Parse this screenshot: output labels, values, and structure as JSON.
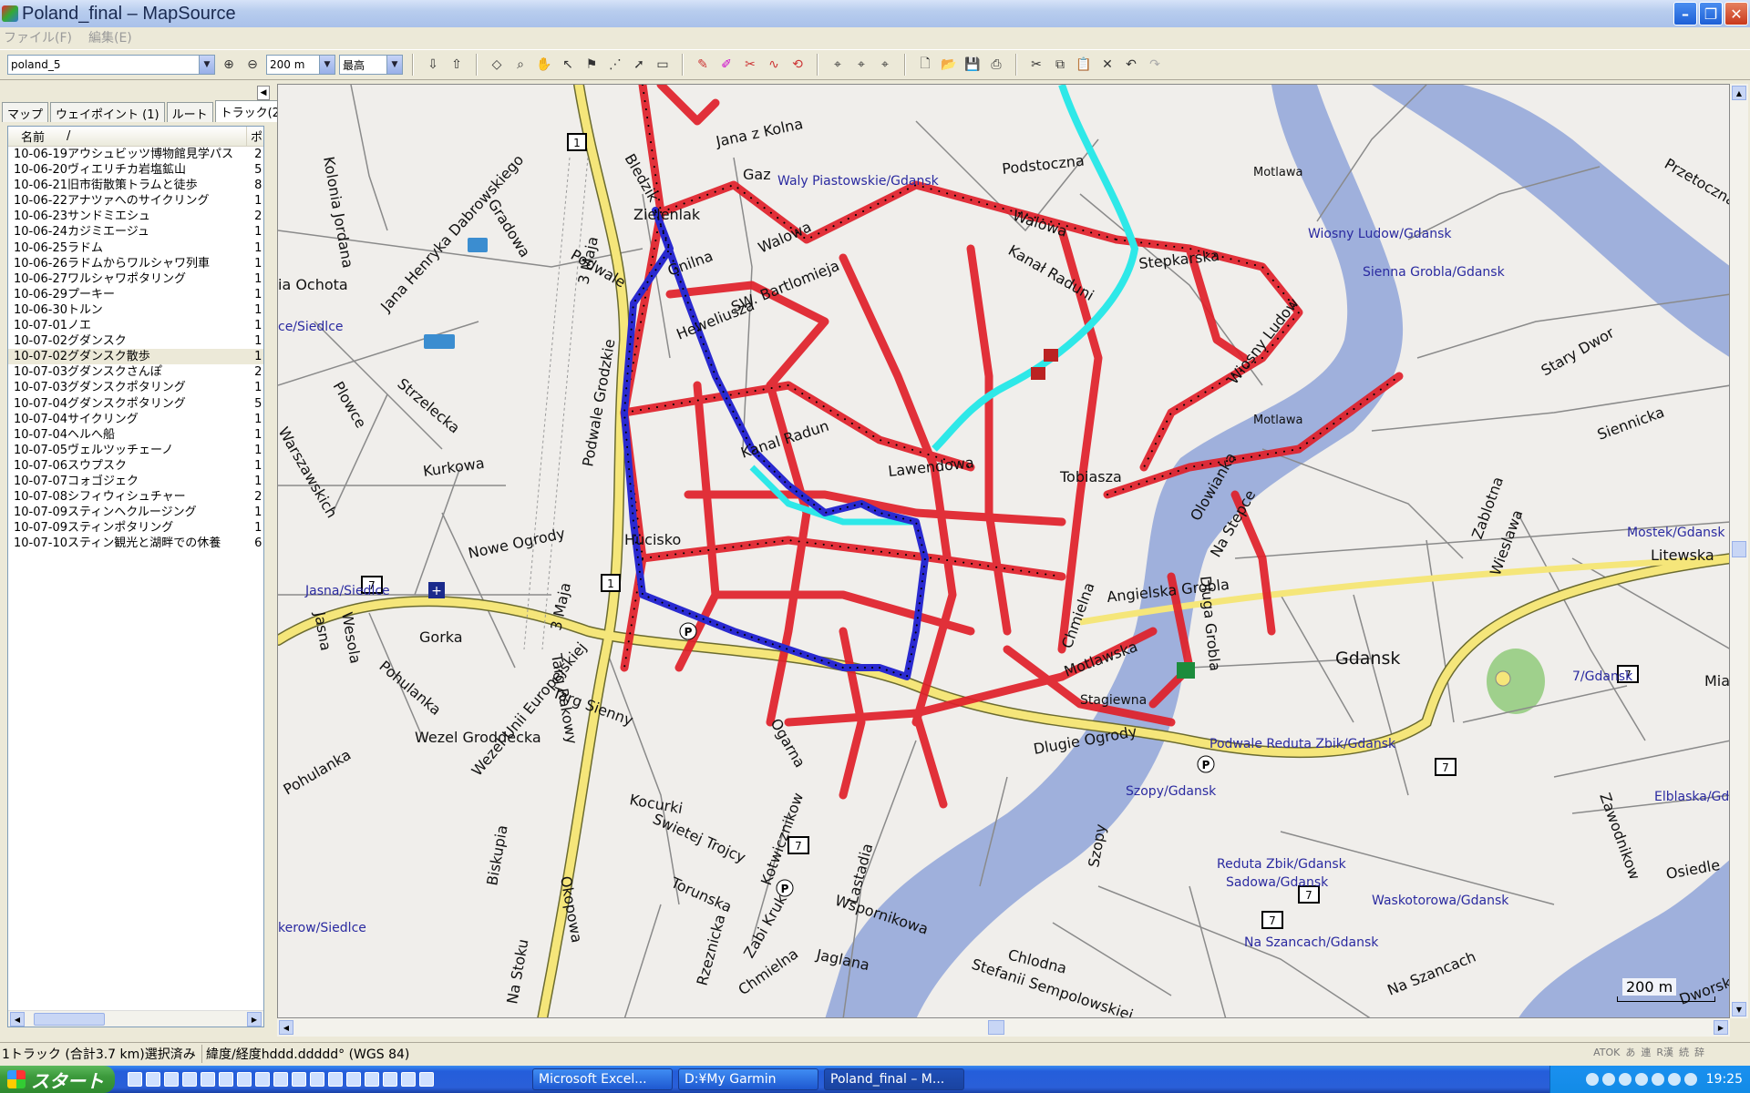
{
  "window": {
    "title": "Poland_final – MapSource"
  },
  "menu": [
    "ファイル(F)",
    "編集(E)"
  ],
  "toolbar": {
    "map_select": "poland_5",
    "zoom": "200 m",
    "detail": "最高"
  },
  "tabs": [
    "マップ",
    "ウェイポイント (1)",
    "ルート",
    "トラック(26)"
  ],
  "list": {
    "col_name": "名前",
    "col_sort": "/",
    "col_points": "ポ",
    "tracks": [
      {
        "name": "10-06-19アウシュビッツ博物館見学パス",
        "v": "2"
      },
      {
        "name": "10-06-20ヴィエリチカ岩塩鉱山",
        "v": "5"
      },
      {
        "name": "10-06-21旧市街散策トラムと徒歩",
        "v": "8"
      },
      {
        "name": "10-06-22アナツァへのサイクリング",
        "v": "1"
      },
      {
        "name": "10-06-23サンドミエシュ",
        "v": "2"
      },
      {
        "name": "10-06-24カジミエージュ",
        "v": "1"
      },
      {
        "name": "10-06-25ラドム",
        "v": "1"
      },
      {
        "name": "10-06-26ラドムからワルシャワ列車",
        "v": "1"
      },
      {
        "name": "10-06-27ワルシャワポタリング",
        "v": "1"
      },
      {
        "name": "10-06-29プーキー",
        "v": "1"
      },
      {
        "name": "10-06-30トルン",
        "v": "1"
      },
      {
        "name": "10-07-01ノエ",
        "v": "1"
      },
      {
        "name": "10-07-02グダンスク",
        "v": "1"
      },
      {
        "name": "10-07-02グダンスク散歩",
        "v": "1"
      },
      {
        "name": "10-07-03グダンスクさんぽ",
        "v": "2"
      },
      {
        "name": "10-07-03グダンスクポタリング",
        "v": "1"
      },
      {
        "name": "10-07-04グダンスクポタリング",
        "v": "5"
      },
      {
        "name": "10-07-04サイクリング",
        "v": "1"
      },
      {
        "name": "10-07-04ヘルへ船",
        "v": "1"
      },
      {
        "name": "10-07-05ヴェルツッチェーノ",
        "v": "1"
      },
      {
        "name": "10-07-06スウプスク",
        "v": "1"
      },
      {
        "name": "10-07-07コォゴジェク",
        "v": "1"
      },
      {
        "name": "10-07-08シフィウィシュチャー",
        "v": "2"
      },
      {
        "name": "10-07-09スティンヘクルージング",
        "v": "1"
      },
      {
        "name": "10-07-09スティンポタリング",
        "v": "1"
      },
      {
        "name": "10-07-10スティン観光と湖畔での休養",
        "v": "6"
      }
    ],
    "selected_index": 13
  },
  "map": {
    "labels": {
      "jana_z_kolna": "Jana z Kolna",
      "gaz": "Gaz",
      "waly_piastowskie": "Waly Piastowskie/Gdansk",
      "podstoczna": "Podstoczna",
      "walowa1": "Walowa",
      "walowa2": "Walowa",
      "kanal_raduni1": "Kanał Raduni",
      "kanal_raduni2": "Kanal Radun",
      "stepkarska": "Stepkarska",
      "wiosny_ludow_gdansk": "Wiosny Ludow/Gdansk",
      "sienna_grobla": "Sienna Grobla/Gdansk",
      "wiosny_ludow": "Wiosny Ludow",
      "motlawa1": "Motlawa",
      "motlawa2": "Motlawa",
      "motlawska": "Motlawska",
      "gdansk": "Gdansk",
      "nowe_ogrody": "Nowe Ogrody",
      "hucisko": "Hucisko",
      "kurkowa": "Kurkowa",
      "gorka": "Gorka",
      "wezel_groddecka": "Wezel Groddecka",
      "wezel_unii": "Wezel Unii Europejskiej",
      "kocurki": "Kocurki",
      "swietej_trojcy": "Swietej Trojcy",
      "torunska": "Torunska",
      "chmielna": "Chmielna",
      "wspornikowa": "Wspornikowa",
      "jaglana": "Jaglana",
      "stefanii": "Stefanii Sempolowskiej",
      "chlodna": "Chlodna",
      "na_szancach": "Na Szancach",
      "na_szancach_gdansk": "Na Szancach/Gdansk",
      "angielska_grobla": "Angielska Grobla",
      "dlugie_ogrody": "Dlugie Ogrody",
      "dluga_grobla": "Dluga Grobla",
      "podwale_reduta": "Podwale Reduta Zbik/Gdansk",
      "reduta_zbik": "Reduta Zbik/Gdansk",
      "sadowa_gdansk": "Sadowa/Gdansk",
      "waskotorowa": "Waskotorowa/Gdansk",
      "elblaska": "Elblaska/Gda",
      "litewska": "Litewska",
      "mostek": "Mostek/Gdansk",
      "tobiasza": "Tobiasza",
      "lawendowa": "Lawendowa",
      "podwale_grodzkie": "Podwale Grodzkie",
      "heweliusza": "Heweliusza",
      "sw_bartlomieja": "SW. Bartlomieja",
      "gnilna": "Gnilna",
      "targ_sienny": "Targ Sienny",
      "targ_rakowy": "Targ Rakowy",
      "okopowa": "Okopowa",
      "biskupia": "Biskupia",
      "na_stoku": "Na Stoku",
      "ogarna": "Ogarna",
      "chmielna2": "Chmielna",
      "olowianka": "Olowianka",
      "na_stepce": "Na Stepce",
      "zabi_kruk": "Zabi Kruk",
      "rzeznicka": "Rzeznicka",
      "lastadia": "Lastadia",
      "kotwicznikow": "Kotwicznikow",
      "szopy_gdansk": "Szopy/Gdansk",
      "szopy": "Szopy",
      "stagiewna": "Stagiewna",
      "stary_dwor": "Stary Dwor",
      "siennicka": "Siennicka",
      "wieslawa": "Wieslawa",
      "zabi": "Zablotna",
      "przetoczna": "Przetoczna",
      "gradowa": "Gradowa",
      "jana_henryka": "Jana Henryka Dabrowskiego",
      "kolonia_jordana": "Kolonia Jordana",
      "ochota": "ia Ochota",
      "siedlce1": "ce/Siedlce",
      "jasna_siedlce": "Jasna/Siedlce",
      "kierow_siedlce": "kerow/Siedlce",
      "jasna": "Jasna",
      "wesola": "Wesola",
      "pohulanka1": "Pohulanka",
      "pohulanka2": "Pohulanka",
      "plowce": "Plowce",
      "strzelecka": "Strzelecka",
      "warszawskich": "Warszawskich",
      "trzy_maja1": "3 Maja",
      "trzy_maja2": "3 Maja",
      "bledzik": "Bledzik",
      "zielonak": "Zielenlak",
      "podwale": "Podwale",
      "kr7_gdansk": "7/Gdansk",
      "osiedle": "Osiedle",
      "zawodnikow": "Zawodnikow",
      "mial": "Mia",
      "dworska": "Dworsk"
    },
    "road_shields": {
      "r1": "1",
      "r7": "7"
    },
    "scale": "200 m"
  },
  "status": {
    "tracks_selected": "1トラック (合計3.7 km)選択済み",
    "coord_format": "緯度/経度hddd.ddddd° (WGS 84)"
  },
  "ime": [
    "ATOK",
    "あ",
    "連",
    "R漢",
    "続",
    "辞"
  ],
  "taskbar": {
    "start": "スタート",
    "tasks": [
      "Microsoft Excel...",
      "D:¥My Garmin",
      "Poland_final – M..."
    ],
    "clock": "19:25"
  }
}
